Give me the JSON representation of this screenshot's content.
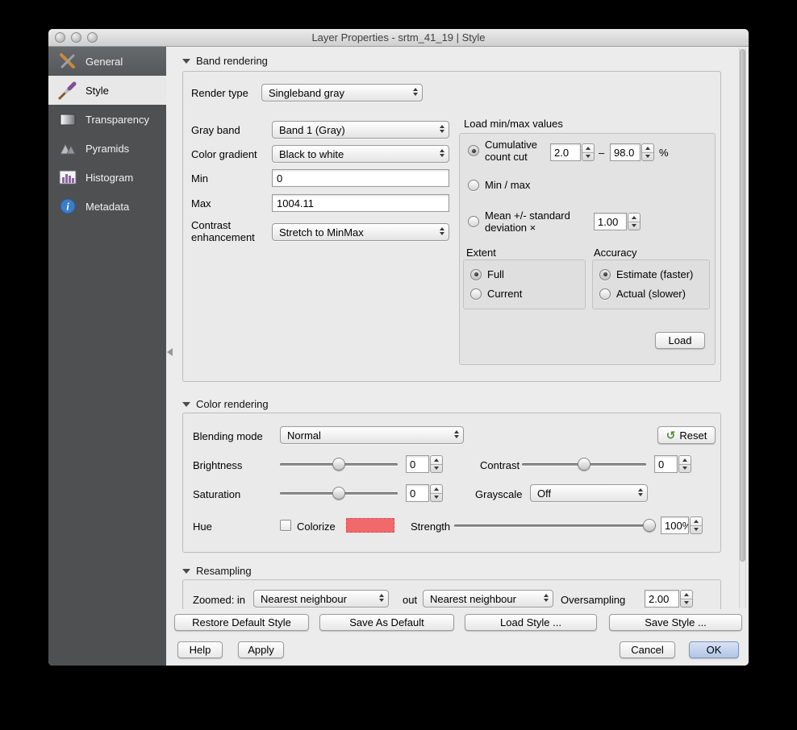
{
  "window": {
    "title": "Layer Properties - srtm_41_19 | Style"
  },
  "sidebar": {
    "items": [
      {
        "label": "General"
      },
      {
        "label": "Style"
      },
      {
        "label": "Transparency"
      },
      {
        "label": "Pyramids"
      },
      {
        "label": "Histogram"
      },
      {
        "label": "Metadata"
      }
    ]
  },
  "band": {
    "header": "Band rendering",
    "render_type_label": "Render type",
    "render_type_value": "Singleband gray",
    "gray_band_label": "Gray band",
    "gray_band_value": "Band 1 (Gray)",
    "color_gradient_label": "Color gradient",
    "color_gradient_value": "Black to white",
    "min_label": "Min",
    "min_value": "0",
    "max_label": "Max",
    "max_value": "1004.11",
    "contrast_label": "Contrast enhancement",
    "contrast_value": "Stretch to MinMax",
    "load_title": "Load min/max values",
    "cumulative_label": "Cumulative count cut",
    "cumulative_min": "2.0",
    "range_dash": "–",
    "cumulative_max": "98.0",
    "percent": "%",
    "minmax_label": "Min / max",
    "mean_label": "Mean +/- standard deviation ×",
    "mean_value": "1.00",
    "extent_title": "Extent",
    "extent_full": "Full",
    "extent_current": "Current",
    "accuracy_title": "Accuracy",
    "accuracy_estimate": "Estimate (faster)",
    "accuracy_actual": "Actual (slower)",
    "load_button": "Load"
  },
  "color": {
    "header": "Color rendering",
    "blending_label": "Blending mode",
    "blending_value": "Normal",
    "reset_label": "Reset",
    "brightness_label": "Brightness",
    "brightness_value": "0",
    "contrast_label": "Contrast",
    "contrast_value": "0",
    "saturation_label": "Saturation",
    "saturation_value": "0",
    "grayscale_label": "Grayscale",
    "grayscale_value": "Off",
    "hue_label": "Hue",
    "colorize_label": "Colorize",
    "swatch_color": "#f2696c",
    "strength_label": "Strength",
    "strength_value": "100%"
  },
  "resampling": {
    "header": "Resampling",
    "zoomed_label": "Zoomed: in",
    "zoomed_in_value": "Nearest neighbour",
    "out_label": "out",
    "zoomed_out_value": "Nearest neighbour",
    "oversampling_label": "Oversampling",
    "oversampling_value": "2.00"
  },
  "footer": {
    "restore_default": "Restore Default Style",
    "save_as_default": "Save As Default",
    "load_style": "Load Style ...",
    "save_style": "Save Style ...",
    "help": "Help",
    "apply": "Apply",
    "cancel": "Cancel",
    "ok": "OK"
  }
}
